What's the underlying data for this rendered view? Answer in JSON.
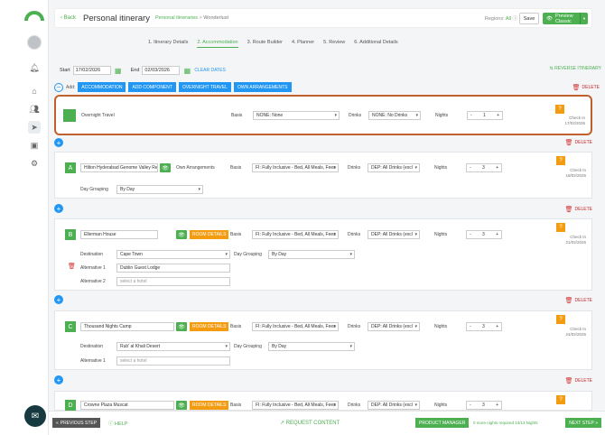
{
  "header": {
    "back_label": "Back",
    "title": "Personal itinerary",
    "breadcrumb_parent": "Personal itineraries",
    "breadcrumb_sep": ">",
    "breadcrumb_current": "Wonderlust",
    "regions_label": "Regions:",
    "regions_value": "All",
    "save_label": "Save",
    "preview_label": "Preview Classic"
  },
  "steps": [
    "1. Itinerary Details",
    "2. Accommodation",
    "3. Route Builder",
    "4. Planner",
    "5. Review",
    "6. Additional Details"
  ],
  "dates": {
    "start_label": "Start",
    "start_value": "17/02/2026",
    "end_label": "End",
    "end_value": "02/03/2026",
    "clear_label": "CLEAR DATES",
    "reverse_label": "REVERSE ITINERARY"
  },
  "add": {
    "label": "Add:",
    "buttons": [
      "ACCOMMODATION",
      "ADD COMPONENT",
      "OVERNIGHT TRAVEL",
      "OWN ARRANGEMENTS"
    ],
    "delete_label": "DELETE"
  },
  "labels": {
    "basis": "Basis",
    "drinks": "Drinks",
    "nights": "Nights",
    "check_in": "Check In",
    "day_grouping": "Day Grouping",
    "own_arrangements": "Own Arrangements",
    "room_details": "ROOM DETAILS",
    "destination": "Destination",
    "alternative_1": "Alternative 1",
    "alternative_2": "Alternative 2",
    "delete": "DELETE",
    "minus": "-",
    "plus": "+",
    "qmark": "?"
  },
  "cards": {
    "overnight": {
      "name": "Overnight Travel",
      "basis": "NONE: None",
      "drinks": "NONE: No Drinks",
      "nights": "1",
      "check_in_date": "17/02/2026"
    },
    "a": {
      "letter": "A",
      "hotel": "Hilton Hyderabad Genome Valley Res",
      "basis": "FI: Fully Inclusive - Bed, All Meals, Fees",
      "drinks": "DEP: All Drinks (excl",
      "nights": "3",
      "check_in_date": "18/02/2026",
      "day_grouping": "By Day"
    },
    "b": {
      "letter": "B",
      "hotel": "Ellerman House",
      "basis": "FI: Fully Inclusive - Bed, All Meals, Fees",
      "drinks": "DEP: All Drinks (excl",
      "nights": "3",
      "check_in_date": "21/02/2026",
      "destination": "Cape Town",
      "day_grouping": "By Day",
      "alternative_1": "Dublin Guest Lodge",
      "alternative_2_placeholder": "select a hotel"
    },
    "c": {
      "letter": "C",
      "hotel": "Thousand Nights Camp",
      "basis": "FI: Fully Inclusive - Bed, All Meals, Fees",
      "drinks": "DEP: All Drinks (excl",
      "nights": "3",
      "check_in_date": "24/02/2026",
      "destination": "Rub' al Khali Desert",
      "day_grouping": "By Day",
      "alternative_1_placeholder": "select a hotel"
    },
    "d": {
      "letter": "D",
      "hotel": "Crowne Plaza Muscat",
      "basis": "FI: Fully Inclusive - Bed, All Meals, Fees",
      "drinks": "DEP: All Drinks (excl",
      "nights": "3"
    }
  },
  "footer": {
    "prev_label": "PREVIOUS STEP",
    "help_label": "HELP",
    "request_label": "REQUEST CONTENT",
    "pm_label": "PRODUCT MANAGER",
    "nights_status": "0 more nights required 13/13 Nights",
    "next_label": "NEXT STEP"
  },
  "colors": {
    "accent": "#4caf50",
    "blue": "#2196f3",
    "orange": "#f39c12",
    "delete": "#c62828",
    "highlight": "#c0612c"
  }
}
